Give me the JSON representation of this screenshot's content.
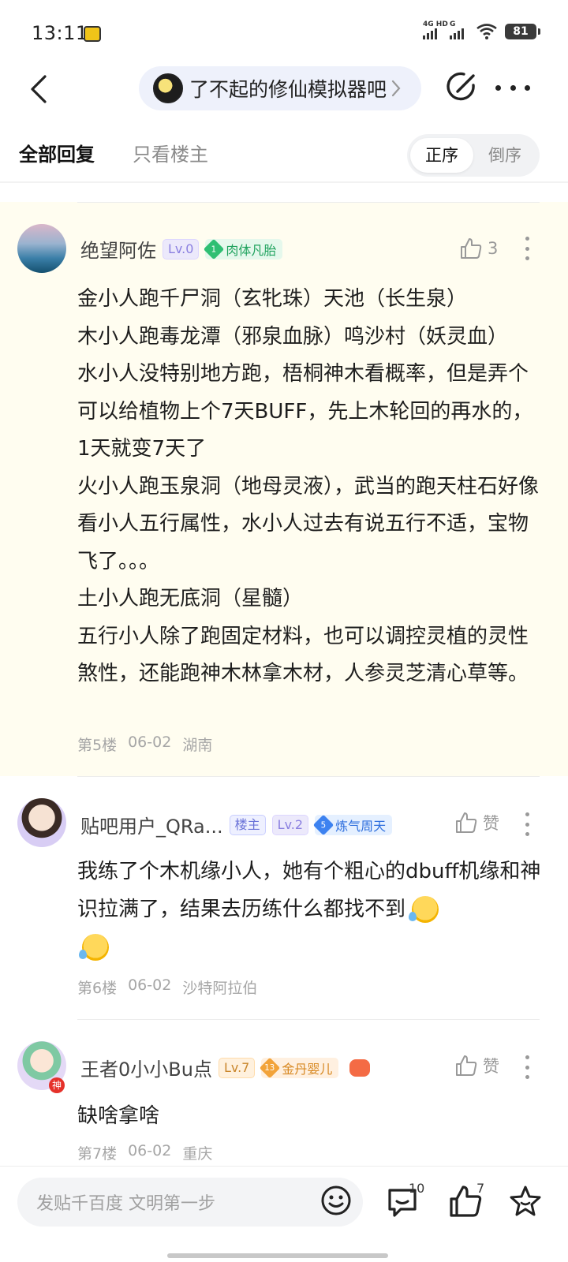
{
  "status_bar": {
    "time": "13:11",
    "network_1": "4G HD",
    "network_2": "G",
    "battery": "81"
  },
  "nav": {
    "forum_name": "了不起的修仙模拟器吧"
  },
  "tabs": {
    "all_replies": "全部回复",
    "op_only": "只看楼主",
    "order_asc": "正序",
    "order_desc": "倒序"
  },
  "posts": [
    {
      "author": "绝望阿佐",
      "level": "Lv.0",
      "title_level": "1",
      "title": "肉体凡胎",
      "likes": "3",
      "body": [
        "金小人跑千尸洞（玄牝珠）天池（长生泉）",
        "木小人跑毒龙潭（邪泉血脉）鸣沙村（妖灵血）",
        "水小人没特别地方跑，梧桐神木看概率，但是弄个可以给植物上个7天BUFF，先上木轮回的再水的，1天就变7天了",
        "火小人跑玉泉洞（地母灵液），武当的跑天柱石好像看小人五行属性，水小人过去有说五行不适，宝物飞了。。。",
        "土小人跑无底洞（星髓）",
        "五行小人除了跑固定材料，也可以调控灵植的灵性煞性，还能跑神木林拿木材，人参灵芝清心草等。"
      ],
      "floor": "第5楼",
      "date": "06-02",
      "location": "湖南"
    },
    {
      "author": "贴吧用户_QRa...",
      "op_badge": "楼主",
      "level": "Lv.2",
      "title_level": "5",
      "title": "炼气周天",
      "likes": "赞",
      "body": [
        "我练了个木机缘小人，她有个粗心的dbuff机缘和神识拉满了，结果去历练什么都找不到"
      ],
      "floor": "第6楼",
      "date": "06-02",
      "location": "沙特阿拉伯"
    },
    {
      "author": "王者0小小Bu点",
      "avatar_badge": "神",
      "level": "Lv.7",
      "title_level": "13",
      "title": "金丹婴儿",
      "likes": "赞",
      "body": [
        "缺啥拿啥"
      ],
      "floor": "第7楼",
      "date": "06-02",
      "location": "重庆"
    }
  ],
  "bottom_bar": {
    "reply_placeholder": "发贴千百度 文明第一步",
    "comment_count": "10",
    "like_count": "7"
  },
  "colors": {
    "highlight_bg": "#fffdf0",
    "pill_bg": "#eef1fb",
    "meta_gray": "#a6a6a6"
  },
  "icons": [
    "back-arrow-icon",
    "edit-icon",
    "more-dots-icon",
    "thumb-up-icon",
    "emoji-icon",
    "comment-icon",
    "star-icon"
  ]
}
